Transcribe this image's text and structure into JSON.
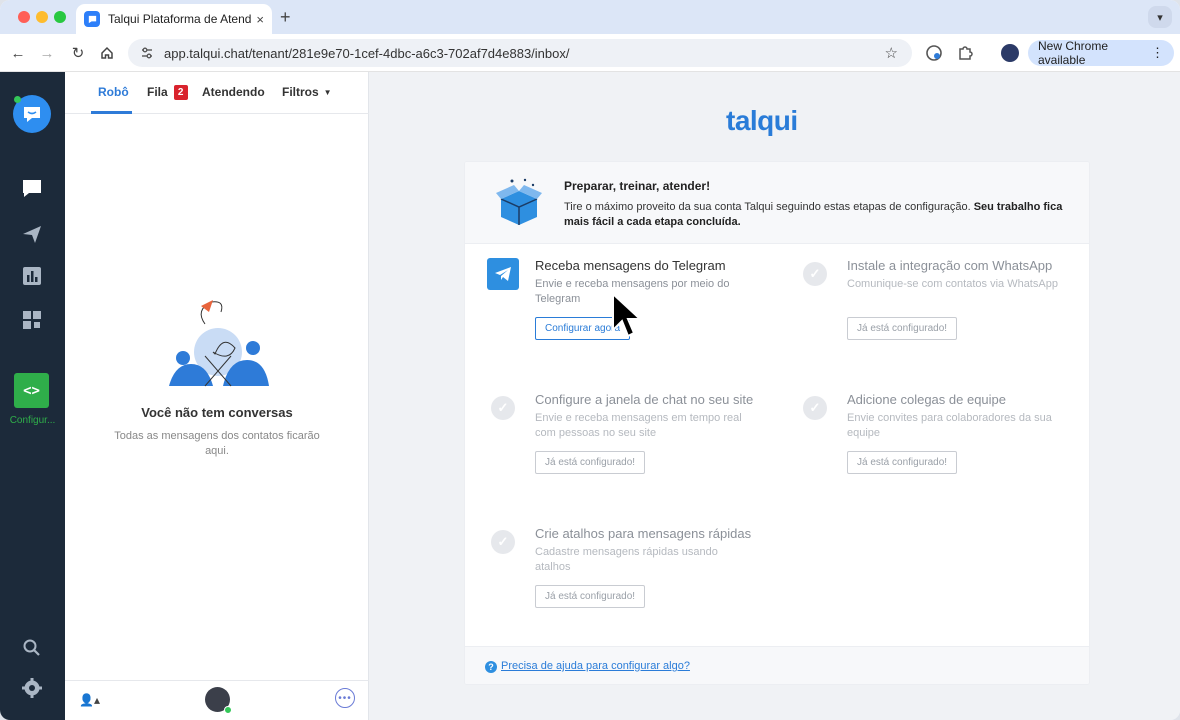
{
  "browser": {
    "tab_title": "Talqui Plataforma de Atendim",
    "tab_close": "×",
    "new_tab": "+",
    "url": "app.talqui.chat/tenant/281e9e70-1cef-4dbc-a6c3-702af7d4e883/inbox/",
    "update_label": "New Chrome available",
    "update_menu": "⋮"
  },
  "rail": {
    "config_label": "Configur..."
  },
  "conversations": {
    "tabs": [
      {
        "label": "Robô",
        "active": true
      },
      {
        "label": "Fila",
        "badge": "2"
      },
      {
        "label": "Atendendo"
      },
      {
        "label": "Filtros"
      }
    ],
    "empty_title": "Você não tem conversas",
    "empty_subtitle": "Todas as mensagens dos contatos ficarão aqui."
  },
  "main": {
    "brand": "talqui",
    "header_title": "Preparar, treinar, atender!",
    "header_desc_plain": "Tire o máximo proveito da sua conta Talqui seguindo estas etapas de configuração. ",
    "header_desc_bold": "Seu trabalho fica mais fácil a cada etapa concluída.",
    "steps": [
      {
        "title": "Receba mensagens do Telegram",
        "desc": "Envie e receba mensagens por meio do Telegram",
        "button": "Configurar agora",
        "state": "active"
      },
      {
        "title": "Instale a integração com WhatsApp",
        "desc": "Comunique-se com contatos via WhatsApp",
        "button": "Já está configurado!",
        "state": "done"
      },
      {
        "title": "Configure a janela de chat no seu site",
        "desc": "Envie e receba mensagens em tempo real com pessoas no seu site",
        "button": "Já está configurado!",
        "state": "done"
      },
      {
        "title": "Adicione colegas de equipe",
        "desc": "Envie convites para colaboradores da sua equipe",
        "button": "Já está configurado!",
        "state": "done"
      },
      {
        "title": "Crie atalhos para mensagens rápidas",
        "desc": "Cadastre mensagens rápidas usando atalhos",
        "button": "Já está configurado!",
        "state": "done"
      }
    ],
    "help_link": "Precisa de ajuda para configurar algo?",
    "help_icon_glyph": "?"
  },
  "colors": {
    "brand_blue": "#2a7cd8",
    "rail_bg": "#1c2a3a",
    "config_green": "#2fae4a",
    "badge_red": "#d9232d"
  }
}
